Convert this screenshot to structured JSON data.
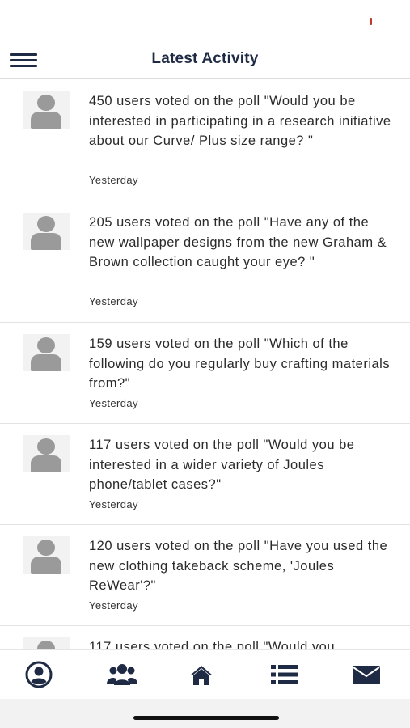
{
  "header": {
    "title": "Latest Activity"
  },
  "activity": [
    {
      "text": "450 users voted on the poll \"Would you be interested in participating in a research initiative about our Curve/ Plus size range? \"",
      "time": "Yesterday"
    },
    {
      "text": "205 users voted on the poll \"Have any of the new wallpaper designs from the new Graham & Brown collection caught your eye? \"",
      "time": "Yesterday"
    },
    {
      "text": "159 users voted on the poll \"Which of the following do you regularly buy crafting materials from?\"",
      "time": "Yesterday"
    },
    {
      "text": "117 users voted on the poll \"Would you be interested in a wider variety of Joules phone/tablet cases?\"",
      "time": "Yesterday"
    },
    {
      "text": "120 users voted on the poll \"Have you used the new clothing takeback scheme, 'Joules ReWear'?\"",
      "time": "Yesterday"
    },
    {
      "text": "117 users voted on the poll \"Would you",
      "time": ""
    }
  ],
  "tabbar": {
    "tabs": [
      {
        "icon": "profile-icon"
      },
      {
        "icon": "users-group-icon"
      },
      {
        "icon": "home-icon"
      },
      {
        "icon": "list-icon"
      },
      {
        "icon": "mail-icon"
      }
    ]
  },
  "colors": {
    "accent": "#1f2a44",
    "avatar": "#9a9a9a",
    "divider": "#e3e3e3"
  }
}
